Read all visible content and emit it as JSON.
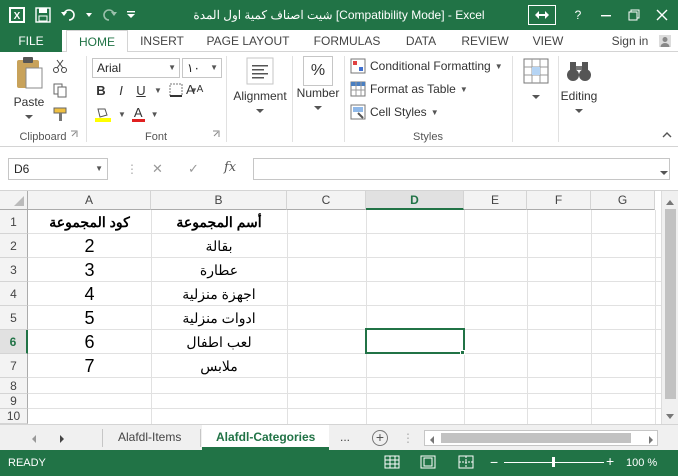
{
  "window": {
    "title": "شيت اصناف كمية اول المدة  [Compatibility Mode] - Excel",
    "help_label": "?"
  },
  "ribbon_tabs": [
    "FILE",
    "HOME",
    "INSERT",
    "PAGE LAYOUT",
    "FORMULAS",
    "DATA",
    "REVIEW",
    "VIEW"
  ],
  "sign_in": "Sign in",
  "clipboard": {
    "paste": "Paste",
    "label": "Clipboard"
  },
  "font": {
    "name": "Arial",
    "size": "١٠",
    "label": "Font",
    "bold": "B",
    "italic": "I",
    "underline": "U",
    "font_color_letter": "A",
    "grow_letter": "A",
    "shrink_letter": "A"
  },
  "alignment": {
    "label": "Alignment"
  },
  "number": {
    "label": "Number",
    "icon_text": "%"
  },
  "styles": {
    "conditional": "Conditional Formatting",
    "table": "Format as Table",
    "cell_styles": "Cell Styles",
    "label": "Styles"
  },
  "cells": {
    "a1": "كود المجموعة",
    "b1": "أسم المجموعة",
    "a2": "2",
    "b2": "بقالة",
    "a3": "3",
    "b3": "عطارة",
    "a4": "4",
    "b4": "اجهزة منزلية",
    "a5": "5",
    "b5": "ادوات منزلية",
    "a6": "6",
    "b6": "لعب اطفال",
    "a7": "7",
    "b7": "ملابس"
  },
  "editing": {
    "label": "Editing"
  },
  "formula_bar": {
    "name_box": "D6",
    "fx": "fx",
    "cancel": "✕",
    "enter": "✓",
    "value": ""
  },
  "columns": [
    "A",
    "B",
    "C",
    "D",
    "E",
    "F",
    "G"
  ],
  "rows": [
    "1",
    "2",
    "3",
    "4",
    "5",
    "6",
    "7",
    "8",
    "9",
    "10"
  ],
  "selected_col": "D",
  "selected_row": "6",
  "sheets": {
    "tab1": "Alafdl-Items",
    "tab2": "Alafdl-Categories",
    "more": "..."
  },
  "status": {
    "ready": "READY",
    "zoom": "100 %"
  },
  "colors": {
    "accent": "#217346"
  }
}
